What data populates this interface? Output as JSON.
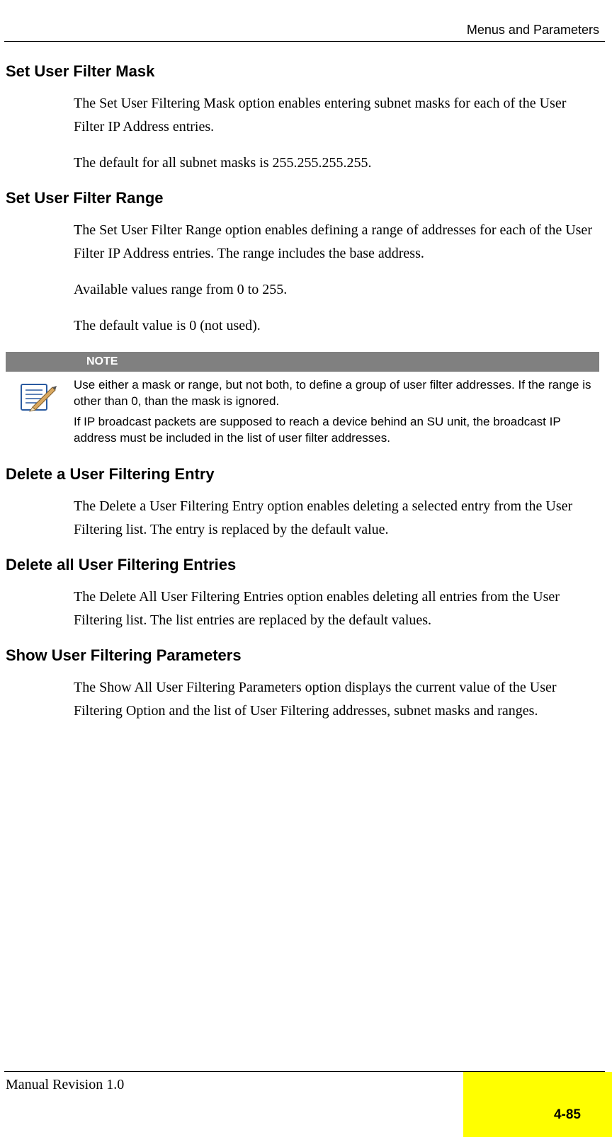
{
  "header": {
    "title": "Menus and Parameters"
  },
  "sections": [
    {
      "heading": "Set User Filter Mask",
      "paragraphs": [
        "The Set User Filtering Mask option enables entering subnet masks for each of the User Filter IP Address entries.",
        "The default for all subnet masks is 255.255.255.255."
      ]
    },
    {
      "heading": "Set User Filter Range",
      "paragraphs": [
        "The Set User Filter Range option enables defining a range of addresses for each of the User Filter IP Address entries. The range includes the base address.",
        "Available values range from 0 to 255.",
        "The default value is 0 (not used)."
      ]
    }
  ],
  "note": {
    "label": "NOTE",
    "lines": [
      "Use either a mask or range, but not both, to define a group of user filter addresses. If the range is other than 0, than the mask is ignored.",
      "If IP broadcast packets are supposed to reach a device behind an SU unit, the broadcast IP address must be included in the list of user filter addresses."
    ]
  },
  "sections2": [
    {
      "heading": "Delete a User Filtering Entry",
      "paragraphs": [
        "The Delete a User Filtering Entry option enables deleting a selected entry from the User Filtering list. The entry is replaced by the default value."
      ]
    },
    {
      "heading": "Delete all User Filtering Entries",
      "paragraphs": [
        "The Delete All User Filtering Entries option enables deleting all entries from the User Filtering list. The list entries are replaced by the default values."
      ]
    },
    {
      "heading": "Show User Filtering Parameters",
      "paragraphs": [
        "The Show All User Filtering Parameters option displays the current value of the User Filtering Option and the list of User Filtering addresses, subnet masks and ranges."
      ]
    }
  ],
  "footer": {
    "left": "Manual Revision 1.0",
    "page": "4-85"
  }
}
